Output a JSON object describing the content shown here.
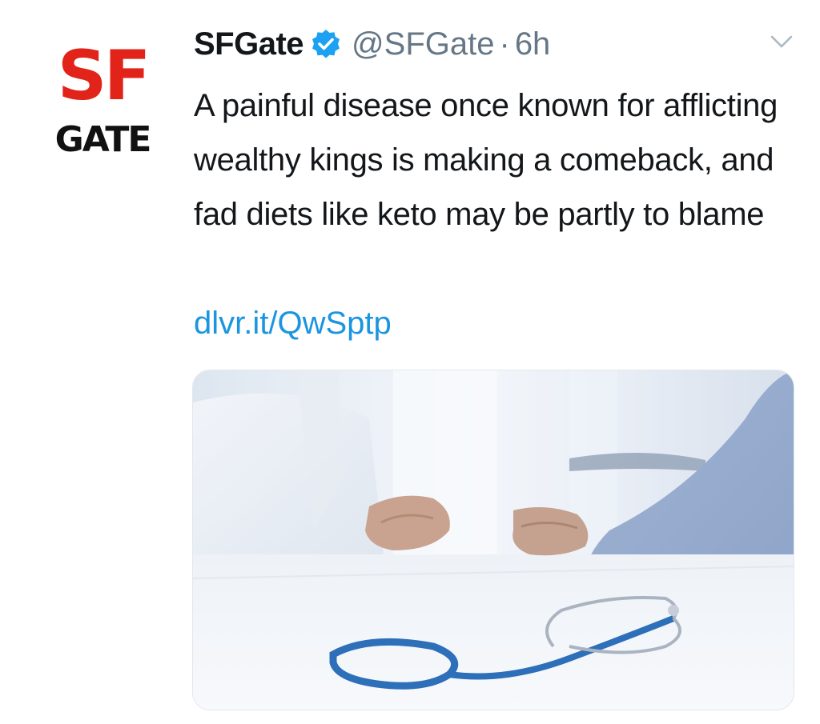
{
  "tweet": {
    "avatar": {
      "logo_line1": "SF",
      "logo_line2": "GATE"
    },
    "author": {
      "display_name": "SFGate",
      "handle": "@SFGate",
      "separator": "·",
      "time": "6h",
      "verified": true
    },
    "text": "A painful disease once known for afflicting wealthy kings is making a comeback, and fad diets like keto may be partly to blame",
    "link": "dlvr.it/QwSptp",
    "media": {
      "icon": "photo"
    },
    "menu_icon": "chevron-down-icon"
  },
  "colors": {
    "brand_red": "#e2231a",
    "link_blue": "#1b95e0",
    "verified_blue": "#1da1f2",
    "secondary_text": "#657786",
    "primary_text": "#14171a"
  }
}
